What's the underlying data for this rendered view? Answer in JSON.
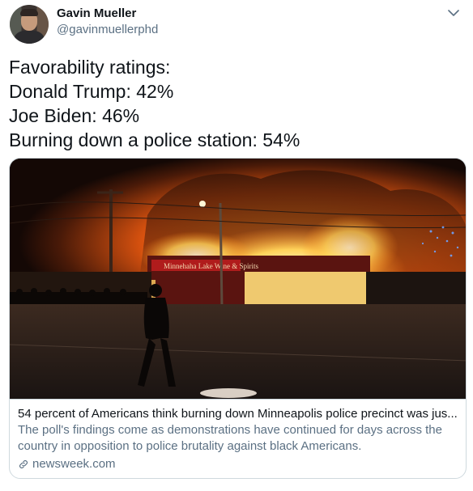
{
  "author": {
    "name": "Gavin Mueller",
    "handle": "@gavinmuellerphd",
    "avatar_icon": "profile-photo"
  },
  "tweet": {
    "lines": [
      "Favorability ratings:",
      "Donald Trump: 42%",
      "Joe Biden: 46%",
      "Burning down a police station: 54%"
    ]
  },
  "card": {
    "title": "54 percent of Americans think burning down Minneapolis police precinct was jus...",
    "description": "The poll's findings come as demonstrations have continued for days across the country in opposition to police brutality against black Americans.",
    "domain": "newsweek.com",
    "image_sign_text": "Minnehaha Lake   Wine & Spirits",
    "link_icon": "link-icon"
  },
  "colors": {
    "text": "#0f1419",
    "secondary": "#5b7083",
    "border": "#cfd9de"
  }
}
